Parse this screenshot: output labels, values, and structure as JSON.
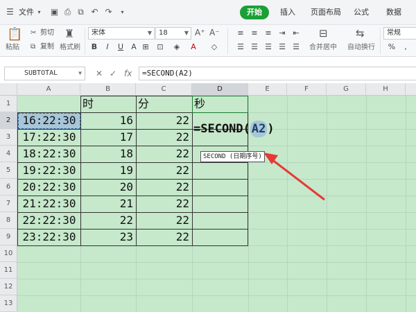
{
  "menu": {
    "file_label": "文件",
    "tabs": [
      {
        "label": "开始",
        "active": true
      },
      {
        "label": "插入",
        "active": false
      },
      {
        "label": "页面布局",
        "active": false
      },
      {
        "label": "公式",
        "active": false
      },
      {
        "label": "数据",
        "active": false
      }
    ]
  },
  "ribbon": {
    "paste_label": "粘贴",
    "cut_label": "剪切",
    "copy_label": "复制",
    "format_painter_label": "格式刷",
    "font_name": "宋体",
    "font_size": "18",
    "merge_label": "合并居中",
    "wrap_label": "自动换行",
    "number_format": "常规"
  },
  "formula_bar": {
    "name_box": "SUBTOTAL",
    "formula": "=SECOND(A2)",
    "fx_label": "fx"
  },
  "grid": {
    "columns": [
      "A",
      "B",
      "C",
      "D",
      "E",
      "F",
      "G",
      "H"
    ],
    "rows": [
      "1",
      "2",
      "3",
      "4",
      "5",
      "6",
      "7",
      "8",
      "9",
      "10",
      "11",
      "12",
      "13"
    ],
    "headers": {
      "b": "时",
      "c": "分",
      "d": "秒"
    },
    "data": [
      {
        "time": "16:22:30",
        "hour": "16",
        "minute": "22"
      },
      {
        "time": "17:22:30",
        "hour": "17",
        "minute": "22"
      },
      {
        "time": "18:22:30",
        "hour": "18",
        "minute": "22"
      },
      {
        "time": "19:22:30",
        "hour": "19",
        "minute": "22"
      },
      {
        "time": "20:22:30",
        "hour": "20",
        "minute": "22"
      },
      {
        "time": "21:22:30",
        "hour": "21",
        "minute": "22"
      },
      {
        "time": "22:22:30",
        "hour": "22",
        "minute": "22"
      },
      {
        "time": "23:22:30",
        "hour": "23",
        "minute": "22"
      }
    ],
    "editing_prefix": "=SECOND(",
    "editing_ref": "A2",
    "editing_suffix": ")",
    "tooltip": "SECOND (日期序号)"
  },
  "colors": {
    "accent": "#1ba035",
    "sheet_bg": "#c6e8cb",
    "arrow": "#e53935"
  }
}
